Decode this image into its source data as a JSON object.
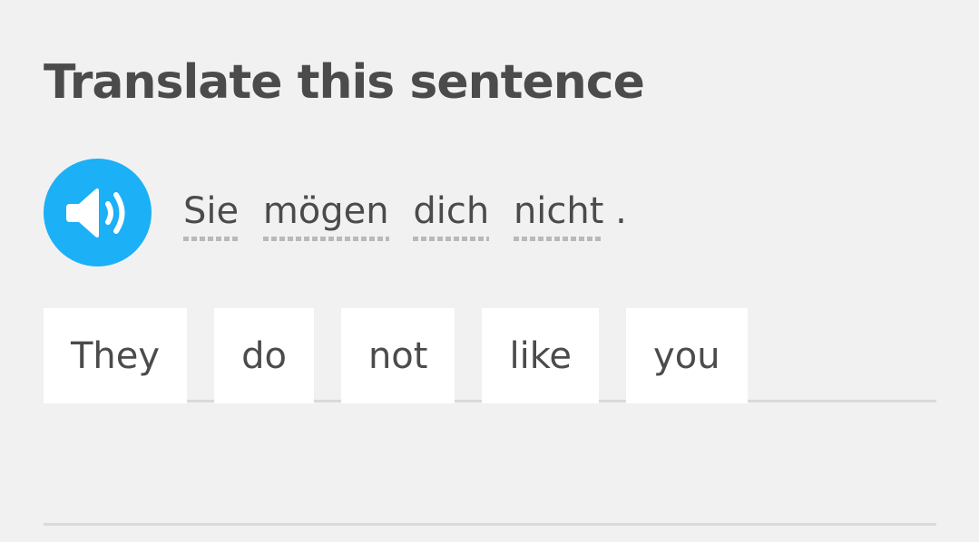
{
  "header": {
    "title": "Translate this sentence"
  },
  "prompt": {
    "speaker_icon": "speaker-volume-icon",
    "words": [
      "Sie",
      "mögen",
      "dich",
      "nicht"
    ],
    "punctuation": "."
  },
  "answer": {
    "tiles": [
      "They",
      "do",
      "not",
      "like",
      "you"
    ]
  },
  "colors": {
    "background": "#f1f1f1",
    "accent": "#1cb0f6",
    "text": "#4b4b4b",
    "tile": "#ffffff",
    "line": "#dadada"
  }
}
